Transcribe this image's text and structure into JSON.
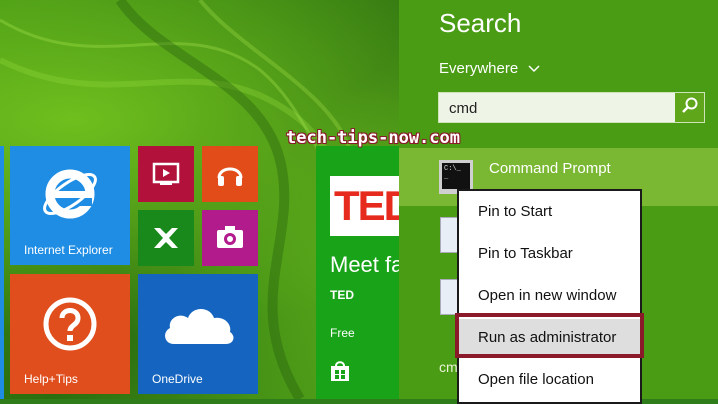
{
  "start_screen": {
    "tiles": {
      "ie": "Internet Explorer",
      "help": "Help+Tips",
      "onedrive": "OneDrive",
      "ted": {
        "logo": "TED",
        "headline": "Meet fa",
        "app_name": "TED",
        "price": "Free"
      }
    }
  },
  "search": {
    "title": "Search",
    "scope": "Everywhere",
    "query": "cmd",
    "results": {
      "top_label": "Command Prompt",
      "rest_text": "cm"
    }
  },
  "context_menu": {
    "items": [
      "Pin to Start",
      "Pin to Taskbar",
      "Open in new window",
      "Run as administrator",
      "Open file location"
    ]
  },
  "watermark": "tech-tips-now.com",
  "colors": {
    "search_pane": "#4a9c14",
    "selected_result": "#7ab833",
    "highlight_border": "#8a1a2a"
  }
}
